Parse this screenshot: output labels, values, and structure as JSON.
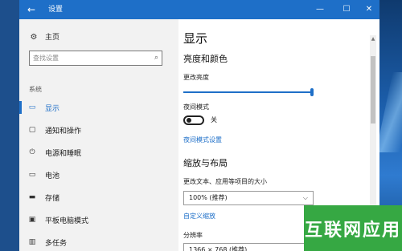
{
  "window": {
    "title": "设置",
    "back_icon": "back-arrow-icon"
  },
  "controls": {
    "minimize": "—",
    "maximize": "☐",
    "close": "✕"
  },
  "sidebar": {
    "home_label": "主页",
    "search_placeholder": "查找设置",
    "section_label": "系统",
    "items": [
      {
        "label": "显示",
        "icon": "display-icon",
        "active": true
      },
      {
        "label": "通知和操作",
        "icon": "notification-icon",
        "active": false
      },
      {
        "label": "电源和睡眠",
        "icon": "power-icon",
        "active": false
      },
      {
        "label": "电池",
        "icon": "battery-icon",
        "active": false
      },
      {
        "label": "存储",
        "icon": "storage-icon",
        "active": false
      },
      {
        "label": "平板电脑模式",
        "icon": "tablet-mode-icon",
        "active": false
      },
      {
        "label": "多任务",
        "icon": "multitasking-icon",
        "active": false
      }
    ]
  },
  "main": {
    "page_title": "显示",
    "brightness_section": "亮度和颜色",
    "brightness_label": "更改亮度",
    "brightness_value": 1.0,
    "night_mode_label": "夜间模式",
    "night_mode_state": "关",
    "night_mode_settings_link": "夜间模式设置",
    "scale_section": "缩放与布局",
    "scale_label": "更改文本、应用等项目的大小",
    "scale_value": "100% (推荐)",
    "custom_scale_link": "自定义缩放",
    "resolution_label": "分辨率",
    "resolution_value": "1366 × 768 (推荐)"
  },
  "watermark": {
    "text": "互联网应用"
  },
  "colors": {
    "accent": "#1e6fc8",
    "sidebar_bg": "#f2f2f2",
    "watermark_bg": "#36a843"
  }
}
